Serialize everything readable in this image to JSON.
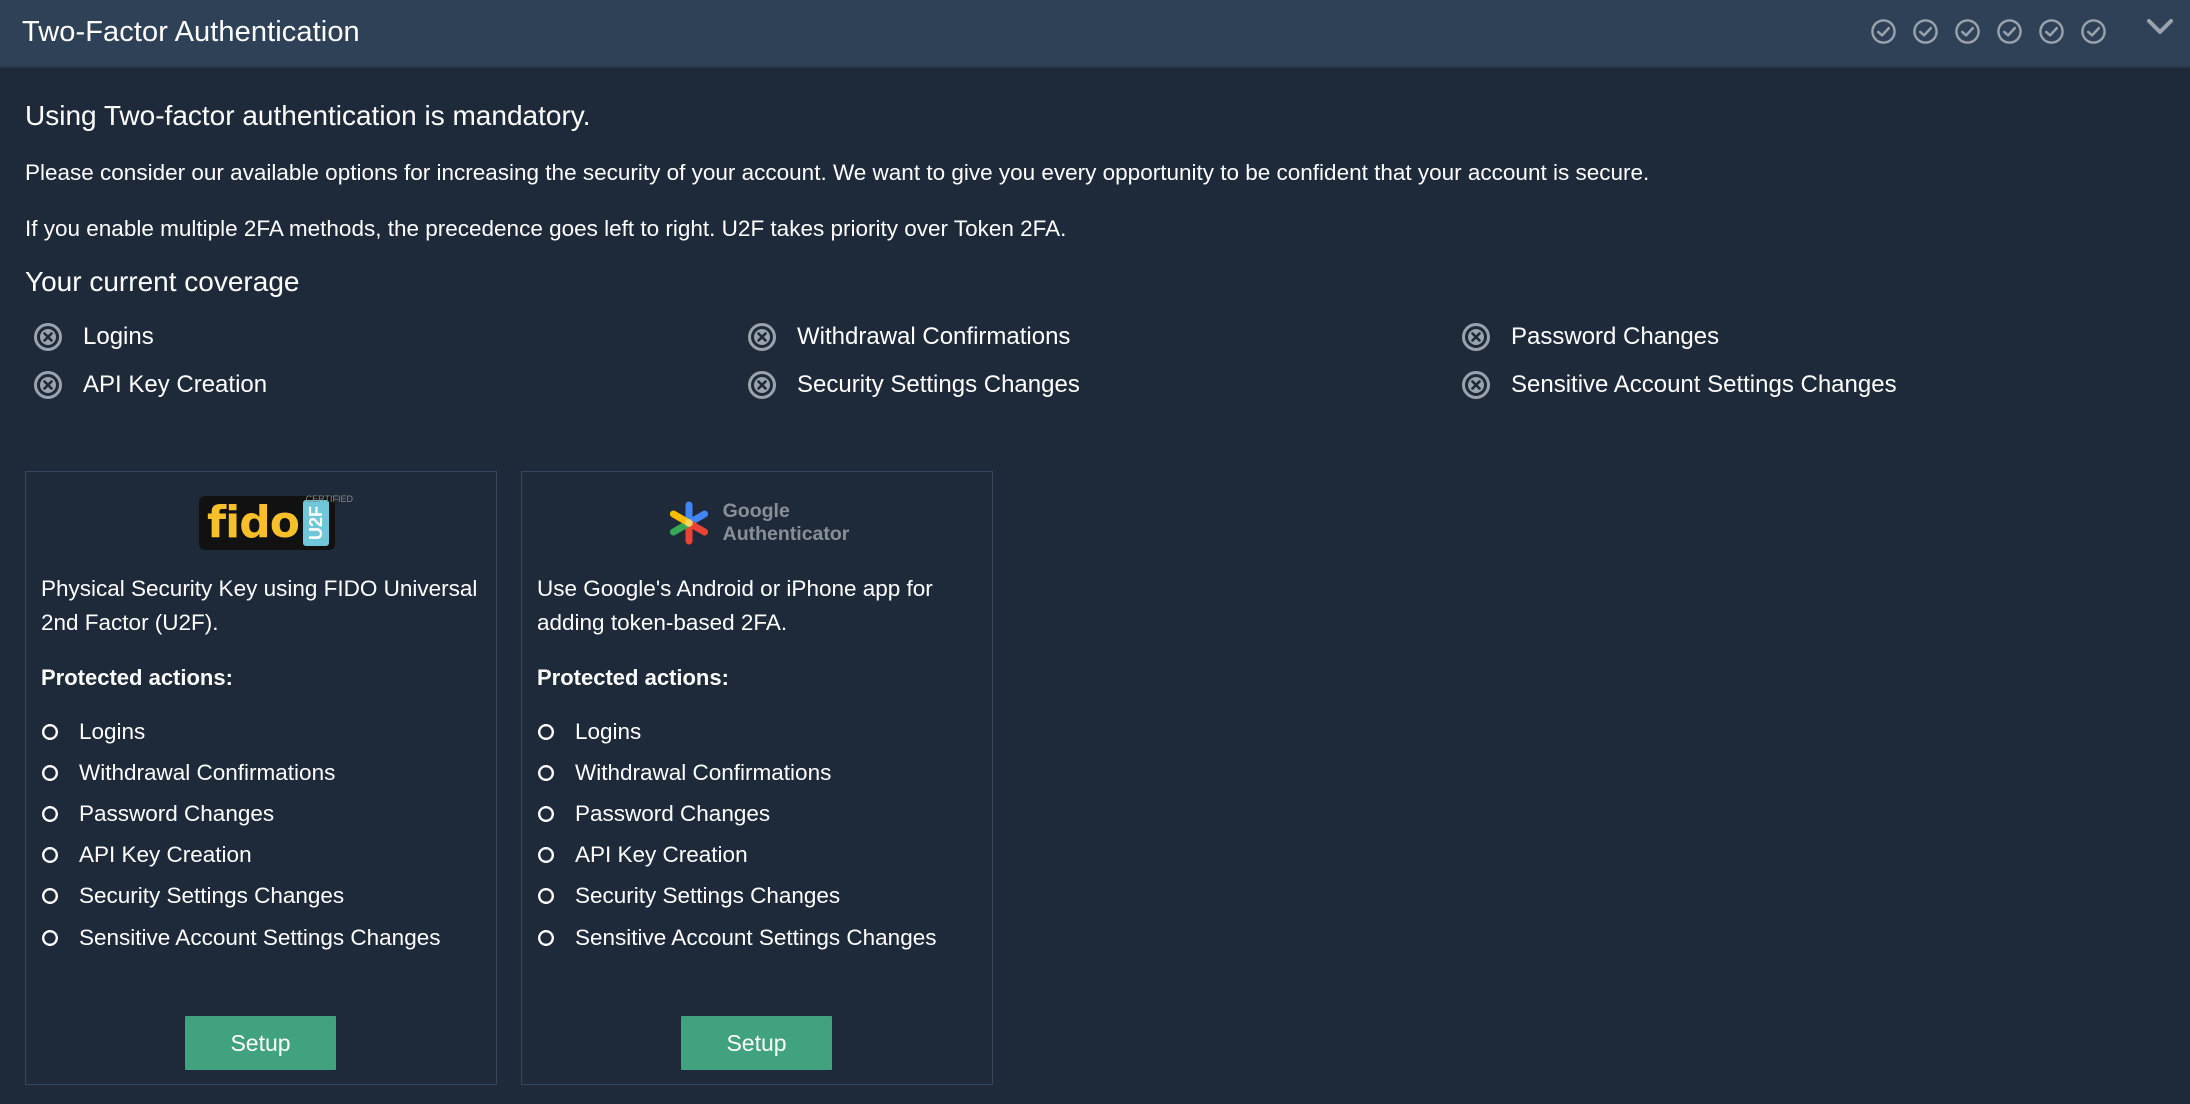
{
  "header": {
    "title": "Two-Factor Authentication",
    "status_icons": [
      "check-circle-icon",
      "check-circle-icon",
      "check-circle-icon",
      "check-circle-icon",
      "check-circle-icon",
      "check-circle-icon"
    ],
    "collapse_icon": "chevron-down-icon"
  },
  "intro": {
    "lead": "Using Two-factor authentication is mandatory.",
    "para1": "Please consider our available options for increasing the security of your account. We want to give you every opportunity to be confident that your account is secure.",
    "para2": "If you enable multiple 2FA methods, the precedence goes left to right. U2F takes priority over Token 2FA."
  },
  "coverage": {
    "title": "Your current coverage",
    "status_icon": "x-circle-icon",
    "items": [
      {
        "label": "Logins",
        "covered": false
      },
      {
        "label": "Withdrawal Confirmations",
        "covered": false
      },
      {
        "label": "Password Changes",
        "covered": false
      },
      {
        "label": "API Key Creation",
        "covered": false
      },
      {
        "label": "Security Settings Changes",
        "covered": false
      },
      {
        "label": "Sensitive Account Settings Changes",
        "covered": false
      }
    ]
  },
  "methods": [
    {
      "logo": "fido-u2f-logo",
      "logo_text": "fido",
      "logo_badge": "U2F",
      "logo_mark": "CERTIFIED",
      "description": "Physical Security Key using FIDO Universal 2nd Factor (U2F).",
      "protected_title": "Protected actions:",
      "actions": [
        "Logins",
        "Withdrawal Confirmations",
        "Password Changes",
        "API Key Creation",
        "Security Settings Changes",
        "Sensitive Account Settings Changes"
      ],
      "button": "Setup"
    },
    {
      "logo": "google-authenticator-logo",
      "logo_line1": "Google",
      "logo_line2": "Authenticator",
      "description": "Use Google's Android or iPhone app for adding token-based 2FA.",
      "protected_title": "Protected actions:",
      "actions": [
        "Logins",
        "Withdrawal Confirmations",
        "Password Changes",
        "API Key Creation",
        "Security Settings Changes",
        "Sensitive Account Settings Changes"
      ],
      "button": "Setup"
    }
  ],
  "colors": {
    "background": "#1e2a3a",
    "header": "#2e4157",
    "button": "#41a280",
    "icon_gray": "#9aa3ad",
    "fido_yellow": "#f7c02b",
    "u2f_blue": "#6fc7d9"
  }
}
